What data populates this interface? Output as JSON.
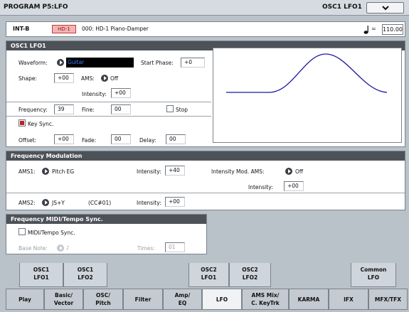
{
  "header": {
    "title": "PROGRAM P5:LFO",
    "page_name": "OSC1 LFO1"
  },
  "program": {
    "bank": "INT-B",
    "badge": "HD-1",
    "name": "000: HD-1 Piano-Damper",
    "tempo_value": "110.00",
    "tempo_eq": "="
  },
  "osc_lfo": {
    "heading": "OSC1 LFO1",
    "waveform_label": "Waveform:",
    "waveform_value": "Guitar",
    "start_phase_label": "Start Phase:",
    "start_phase_value": "+0",
    "shape_label": "Shape:",
    "shape_value": "+00",
    "ams_label": "AMS:",
    "ams_value": "Off",
    "intensity_label": "Intensity:",
    "intensity_value": "+00",
    "frequency_label": "Frequency:",
    "frequency_value": "39",
    "fine_label": "Fine:",
    "fine_value": "00",
    "stop_label": "Stop",
    "key_sync_label": "Key Sync.",
    "offset_label": "Offset:",
    "offset_value": "+00",
    "fade_label": "Fade:",
    "fade_value": "00",
    "delay_label": "Delay:",
    "delay_value": "00"
  },
  "freq_mod": {
    "heading": "Frequency Modulation",
    "ams1_label": "AMS1:",
    "ams1_value": "Pitch EG",
    "intensity1_label": "Intensity:",
    "intensity1_value": "+40",
    "int_mod_ams_label": "Intensity Mod. AMS:",
    "int_mod_ams_value": "Off",
    "int_mod_intensity_label": "Intensity:",
    "int_mod_intensity_value": "+00",
    "ams2_label": "AMS2:",
    "ams2_value": "JS+Y",
    "ams2_cc": "(CC#01)",
    "intensity2_label": "Intensity:",
    "intensity2_value": "+00"
  },
  "midi_tempo": {
    "heading": "Frequency MIDI/Tempo Sync.",
    "sync_label": "MIDI/Tempo Sync.",
    "base_note_label": "Base Note:",
    "base_note_value": "♪",
    "times_label": "Times:",
    "times_value": "01"
  },
  "page_tabs": [
    {
      "line1": "OSC1",
      "line2": "LFO1"
    },
    {
      "line1": "OSC1",
      "line2": "LFO2"
    },
    {
      "line1": "OSC2",
      "line2": "LFO1"
    },
    {
      "line1": "OSC2",
      "line2": "LFO2"
    },
    {
      "line1": "Common",
      "line2": "LFO"
    }
  ],
  "main_tabs": [
    {
      "line1": "Play",
      "line2": ""
    },
    {
      "line1": "Basic/",
      "line2": "Vector"
    },
    {
      "line1": "OSC/",
      "line2": "Pitch"
    },
    {
      "line1": "Filter",
      "line2": ""
    },
    {
      "line1": "Amp/",
      "line2": "EQ"
    },
    {
      "line1": "LFO",
      "line2": ""
    },
    {
      "line1": "AMS Mix/",
      "line2": "C. KeyTrk"
    },
    {
      "line1": "KARMA",
      "line2": ""
    },
    {
      "line1": "IFX",
      "line2": ""
    },
    {
      "line1": "MFX/TFX",
      "line2": ""
    }
  ],
  "colors": {
    "accent": "#1a1aa0",
    "dark_header": "#4d5258",
    "key_sync_red": "#c41d1d",
    "waveform_bg": "#000000",
    "waveform_text": "#3a7bff"
  },
  "icons": {
    "menu": "chevron-down-icon",
    "tempo": "quarter-note-icon",
    "popup": "popup-arrow-icon"
  }
}
